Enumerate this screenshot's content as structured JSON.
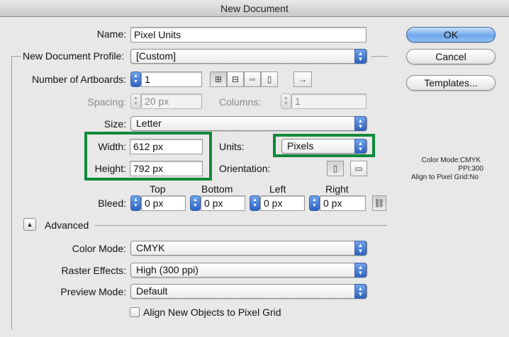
{
  "window": {
    "title": "New Document"
  },
  "name": {
    "label": "Name:",
    "value": "Pixel Units"
  },
  "profile": {
    "label": "New Document Profile:",
    "value": "[Custom]"
  },
  "artboards": {
    "label": "Number of Artboards:",
    "value": "1",
    "arrange_icons": [
      "grid-by-row-icon",
      "grid-by-column-icon",
      "arrange-by-row-icon",
      "arrange-by-column-icon",
      "right-to-left-icon"
    ]
  },
  "spacing": {
    "label": "Spacing:",
    "value": "20 px"
  },
  "columns": {
    "label": "Columns:",
    "value": "1"
  },
  "size": {
    "label": "Size:",
    "value": "Letter"
  },
  "width": {
    "label": "Width:",
    "value": "612 px"
  },
  "height": {
    "label": "Height:",
    "value": "792 px"
  },
  "units": {
    "label": "Units:",
    "value": "Pixels"
  },
  "orientation": {
    "label": "Orientation:",
    "options": [
      "portrait-icon",
      "landscape-icon"
    ],
    "selected": "portrait"
  },
  "bleed": {
    "label": "Bleed:",
    "top": {
      "label": "Top",
      "value": "0 px"
    },
    "bottom": {
      "label": "Bottom",
      "value": "0 px"
    },
    "left": {
      "label": "Left",
      "value": "0 px"
    },
    "right": {
      "label": "Right",
      "value": "0 px"
    },
    "link_icon": "chain-link-icon"
  },
  "advanced": {
    "label": "Advanced"
  },
  "color_mode": {
    "label": "Color Mode:",
    "value": "CMYK"
  },
  "raster_effects": {
    "label": "Raster Effects:",
    "value": "High (300 ppi)"
  },
  "preview_mode": {
    "label": "Preview Mode:",
    "value": "Default"
  },
  "align_pixel_grid": {
    "label": "Align New Objects to Pixel Grid",
    "checked": false
  },
  "buttons": {
    "ok": "OK",
    "cancel": "Cancel",
    "templates": "Templates..."
  },
  "summary": {
    "color_mode": "Color Mode:CMYK",
    "ppi": "PPI:300",
    "align": "Align to Pixel Grid:No"
  },
  "colors": {
    "highlight": "#0e8a3b",
    "accent": "#2d63c2"
  }
}
